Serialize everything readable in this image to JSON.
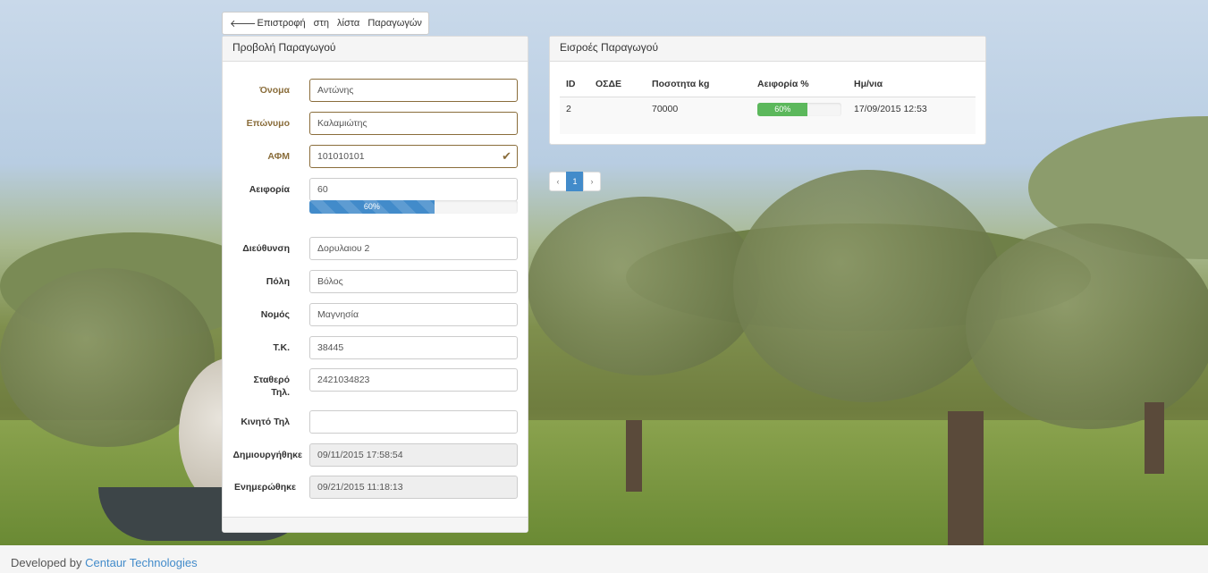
{
  "back_button": {
    "label": "Επιστροφή στη λίστα Παραγωγών",
    "icon": "arrow-left-icon"
  },
  "producer_panel": {
    "title": "Προβολή Παραγωγού",
    "fields": {
      "first_name": {
        "label": "Όνομα",
        "value": "Αντώνης"
      },
      "last_name": {
        "label": "Επώνυμο",
        "value": "Καλαμιώτης"
      },
      "afm": {
        "label": "ΑΦΜ",
        "value": "101010101"
      },
      "sustainability": {
        "label": "Αειφορία",
        "value": "60",
        "progress_label": "60%",
        "progress_percent": 60
      },
      "address": {
        "label": "Διεύθυνση",
        "value": "Δορυλαιου 2"
      },
      "city": {
        "label": "Πόλη",
        "value": "Βόλος"
      },
      "prefecture": {
        "label": "Νομός",
        "value": "Μαγνησία"
      },
      "postal_code": {
        "label": "Τ.Κ.",
        "value": "38445"
      },
      "landline": {
        "label": "Σταθερό Τηλ.",
        "value": "2421034823"
      },
      "mobile": {
        "label": "Κινητό Τηλ",
        "value": ""
      },
      "created": {
        "label": "Δημιουργήθηκε",
        "value": "09/11/2015 17:58:54"
      },
      "updated": {
        "label": "Ενημερώθηκε",
        "value": "09/21/2015 11:18:13"
      }
    }
  },
  "inputs_panel": {
    "title": "Εισροές Παραγωγού",
    "columns": [
      "ID",
      "ΟΣΔΕ",
      "Ποσοτητα kg",
      "Αειφορία %",
      "Ημ/νια"
    ],
    "rows": [
      {
        "id": "2",
        "osde": "",
        "quantity": "70000",
        "sustainability_label": "60%",
        "sustainability_percent": 60,
        "date": "17/09/2015 12:53"
      }
    ]
  },
  "pagination": {
    "prev": "‹",
    "current": "1",
    "next": "›"
  },
  "footer": {
    "prefix": "Developed by",
    "link": "Centaur Technologies"
  },
  "colors": {
    "primary": "#428bca",
    "success": "#5cb85c",
    "warning": "#8a6d3b"
  }
}
